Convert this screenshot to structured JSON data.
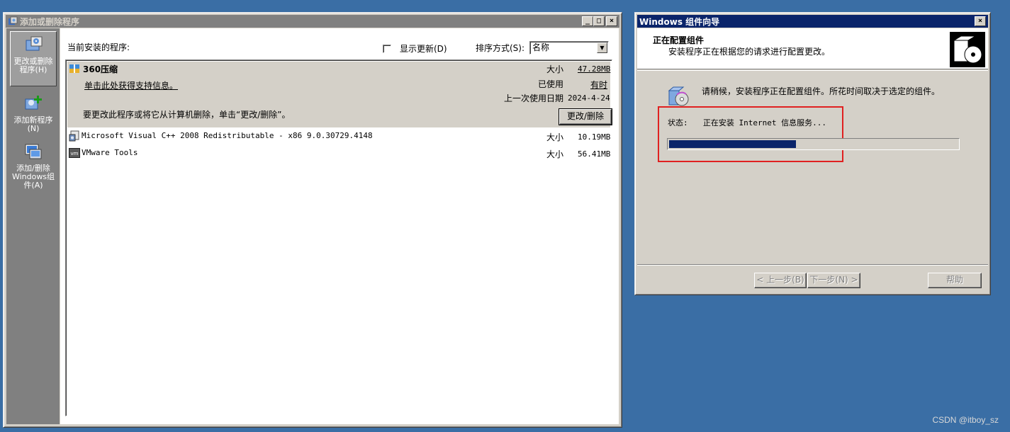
{
  "arp": {
    "title": "添加或删除程序",
    "caption": {
      "min": "_",
      "max": "□",
      "close": "×"
    },
    "sidebar": [
      {
        "label": "更改或删除程序(H)",
        "icon": "change-remove-programs-icon",
        "selected": true
      },
      {
        "label": "添加新程序(N)",
        "icon": "add-new-programs-icon",
        "selected": false
      },
      {
        "label": "添加/删除Windows组件(A)",
        "icon": "windows-components-icon",
        "selected": false
      }
    ],
    "current_label": "当前安装的程序:",
    "show_updates_label": "显示更新(D)",
    "sort_label": "排序方式(S):",
    "sort_value": "名称",
    "selected_program": {
      "name": "360压缩",
      "support_link": "单击此处获得支持信息。",
      "size_label": "大小",
      "size_value": "47.28MB",
      "used_label": "已使用",
      "used_value": "有时",
      "last_used_label": "上一次使用日期",
      "last_used_value": "2024-4-24",
      "change_msg": "要更改此程序或将它从计算机删除，单击“更改/删除”。",
      "change_button": "更改/删除"
    },
    "programs": [
      {
        "name": "Microsoft Visual C++ 2008 Redistributable - x86 9.0.30729.4148",
        "size_label": "大小",
        "size_value": "10.19MB"
      },
      {
        "name": "VMware Tools",
        "size_label": "大小",
        "size_value": "56.41MB"
      }
    ]
  },
  "wizard": {
    "title": "Windows 组件向导",
    "close": "×",
    "header_title": "正在配置组件",
    "header_subtitle": "安装程序正在根据您的请求进行配置更改。",
    "info": "请稍候，安装程序正在配置组件。所花时间取决于选定的组件。",
    "status_label": "状态:",
    "status_value": "正在安装 Internet 信息服务...",
    "progress": 0.44,
    "back_button": "< 上一步(B)",
    "next_button": "下一步(N) >",
    "help_button": "帮助"
  },
  "watermark": "CSDN @itboy_sz"
}
